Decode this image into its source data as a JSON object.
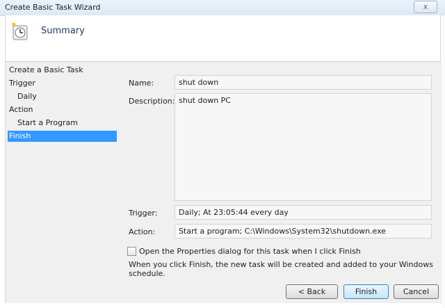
{
  "window": {
    "title": "Create Basic Task Wizard",
    "close_glyph": "x"
  },
  "header": {
    "title": "Summary",
    "icon": "task-scheduler-clock-icon"
  },
  "steps": [
    {
      "label": "Create a Basic Task",
      "indent": false,
      "active": false
    },
    {
      "label": "Trigger",
      "indent": false,
      "active": false
    },
    {
      "label": "Daily",
      "indent": true,
      "active": false
    },
    {
      "label": "Action",
      "indent": false,
      "active": false
    },
    {
      "label": "Start a Program",
      "indent": true,
      "active": false
    },
    {
      "label": "Finish",
      "indent": false,
      "active": true
    }
  ],
  "summary": {
    "name_label": "Name:",
    "name_value": "shut down",
    "description_label": "Description:",
    "description_value": "shut down PC",
    "trigger_label": "Trigger:",
    "trigger_value": "Daily; At 23:05:44 every day",
    "action_label": "Action:",
    "action_value": "Start a program; C:\\Windows\\System32\\shutdown.exe"
  },
  "options": {
    "open_properties_label": "Open the Properties dialog for this task when I click Finish",
    "open_properties_checked": false,
    "info_text": "When you click Finish, the new task will be created and added to your Windows schedule."
  },
  "buttons": {
    "back": "< Back",
    "finish": "Finish",
    "cancel": "Cancel"
  },
  "colors": {
    "selection": "#3399ff",
    "header_title": "#1e3a5f"
  }
}
